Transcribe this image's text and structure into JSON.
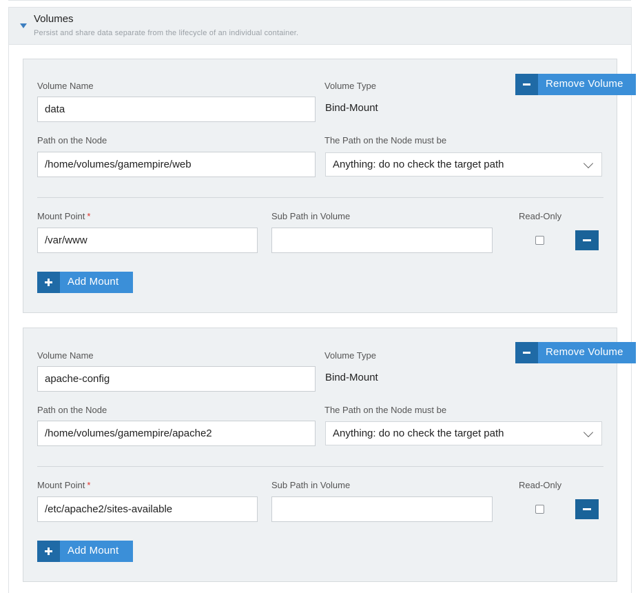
{
  "section": {
    "title": "Volumes",
    "subtitle": "Persist and share data separate from the lifecycle of an individual container."
  },
  "labels": {
    "volume_name": "Volume Name",
    "volume_type": "Volume Type",
    "path_on_node": "Path on the Node",
    "path_must_be": "The Path on the Node must be",
    "mount_point": "Mount Point",
    "required_mark": "*",
    "sub_path": "Sub Path in Volume",
    "read_only": "Read-Only",
    "remove_volume": "Remove Volume",
    "add_mount": "Add Mount"
  },
  "volumes": [
    {
      "name": "data",
      "type": "Bind-Mount",
      "path_on_node": "/home/volumes/gamempire/web",
      "path_check": "Anything: do no check the target path",
      "mounts": [
        {
          "mount_point": "/var/www",
          "sub_path": "",
          "read_only": false
        }
      ]
    },
    {
      "name": "apache-config",
      "type": "Bind-Mount",
      "path_on_node": "/home/volumes/gamempire/apache2",
      "path_check": "Anything: do no check the target path",
      "mounts": [
        {
          "mount_point": "/etc/apache2/sites-available",
          "sub_path": "",
          "read_only": false
        }
      ]
    }
  ]
}
